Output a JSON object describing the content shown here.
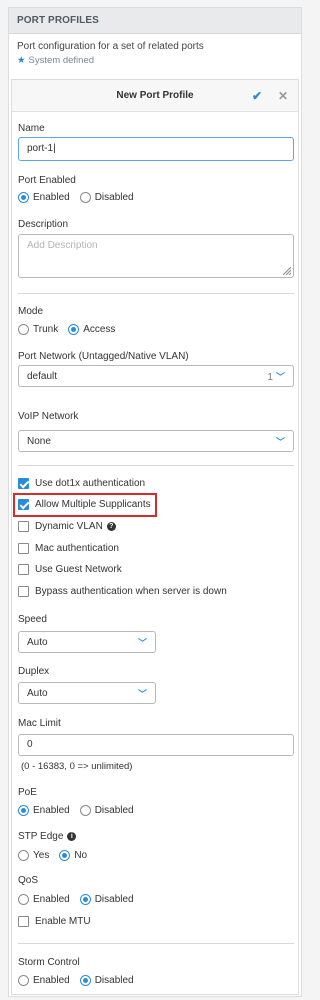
{
  "section": {
    "title": "PORT PROFILES",
    "description": "Port configuration for a set of related ports",
    "system_defined": "System defined"
  },
  "card": {
    "title": "New Port Profile",
    "confirm_icon": "check-icon",
    "close_icon": "close-icon"
  },
  "fields": {
    "name_label": "Name",
    "name_value": "port-1",
    "port_enabled_label": "Port Enabled",
    "port_enabled_options": [
      "Enabled",
      "Disabled"
    ],
    "port_enabled_selected": "Enabled",
    "description_label": "Description",
    "description_placeholder": "Add Description",
    "mode_label": "Mode",
    "mode_options": [
      "Trunk",
      "Access"
    ],
    "mode_selected": "Access",
    "port_network_label": "Port Network (Untagged/Native VLAN)",
    "port_network_value": "default",
    "port_network_vlan": "1",
    "voip_label": "VoIP Network",
    "voip_value": "None",
    "checkboxes": [
      {
        "label": "Use dot1x authentication",
        "checked": true
      },
      {
        "label": "Allow Multiple Supplicants",
        "checked": true
      },
      {
        "label": "Dynamic VLAN",
        "checked": false
      },
      {
        "label": "Mac authentication",
        "checked": false
      },
      {
        "label": "Use Guest Network",
        "checked": false
      },
      {
        "label": "Bypass authentication when server is down",
        "checked": false
      }
    ],
    "speed_label": "Speed",
    "speed_value": "Auto",
    "duplex_label": "Duplex",
    "duplex_value": "Auto",
    "mac_limit_label": "Mac Limit",
    "mac_limit_value": "0",
    "mac_limit_hint": "(0 - 16383, 0 => unlimited)",
    "poe_label": "PoE",
    "poe_options": [
      "Enabled",
      "Disabled"
    ],
    "poe_selected": "Enabled",
    "stp_label": "STP Edge",
    "stp_options": [
      "Yes",
      "No"
    ],
    "stp_selected": "No",
    "qos_label": "QoS",
    "qos_options": [
      "Enabled",
      "Disabled"
    ],
    "qos_selected": "Disabled",
    "mtu_label": "Enable MTU",
    "storm_label": "Storm Control",
    "storm_options": [
      "Enabled",
      "Disabled"
    ],
    "storm_selected": "Disabled"
  },
  "colors": {
    "accent": "#2a8cd8",
    "highlight": "#d62c2c"
  }
}
